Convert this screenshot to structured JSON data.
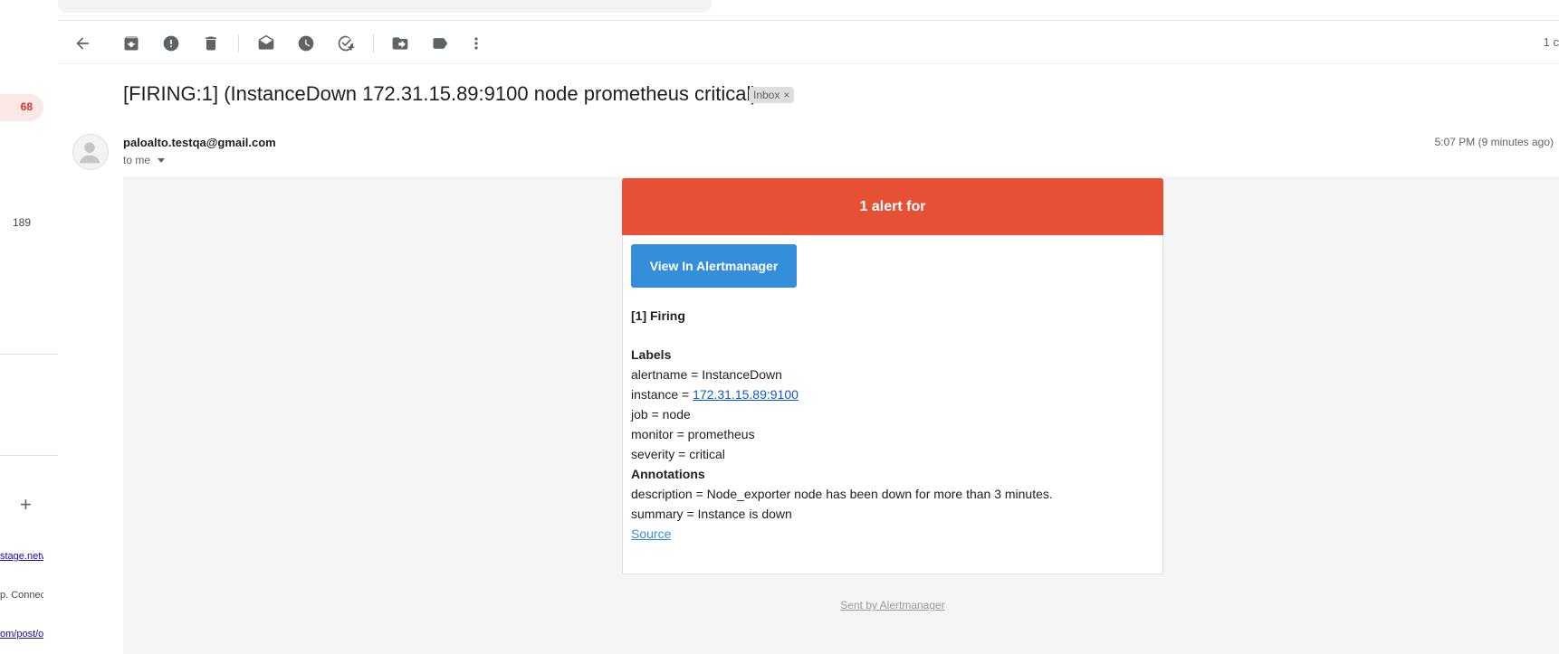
{
  "toolbar": {
    "count_text": "1 c"
  },
  "sidebar": {
    "badge_count": "68",
    "count_2": "189",
    "add_symbol": "+",
    "link_1": "stage.netw",
    "text_2": "p. Connec",
    "link_3": "om/post/o"
  },
  "email": {
    "subject": "[FIRING:1] (InstanceDown 172.31.15.89:9100 node prometheus critical)",
    "label_chip": "Inbox",
    "label_chip_close": "×",
    "sender": "paloalto.testqa@gmail.com",
    "recipient": "to me",
    "time": "5:07 PM (9 minutes ago)"
  },
  "alert": {
    "header": "1 alert for",
    "button": "View In Alertmanager",
    "firing_title": "[1] Firing",
    "labels_heading": "Labels",
    "alertname": "alertname = InstanceDown",
    "instance_prefix": "instance = ",
    "instance_link": "172.31.15.89:9100",
    "job": "job = node",
    "monitor": "monitor = prometheus",
    "severity": "severity = critical",
    "annotations_heading": "Annotations",
    "description": "description = Node_exporter node has been down for more than 3 minutes.",
    "summary": "summary = Instance is down",
    "source_link": "Source",
    "footer": "Sent by Alertmanager"
  },
  "colors": {
    "alert_header": "#e65136",
    "button": "#348eda",
    "badge": "#d93025"
  },
  "icons": [
    "back-arrow-icon",
    "archive-icon",
    "report-spam-icon",
    "delete-icon",
    "mark-unread-icon",
    "snooze-icon",
    "add-task-icon",
    "move-to-icon",
    "label-icon",
    "more-options-icon"
  ]
}
